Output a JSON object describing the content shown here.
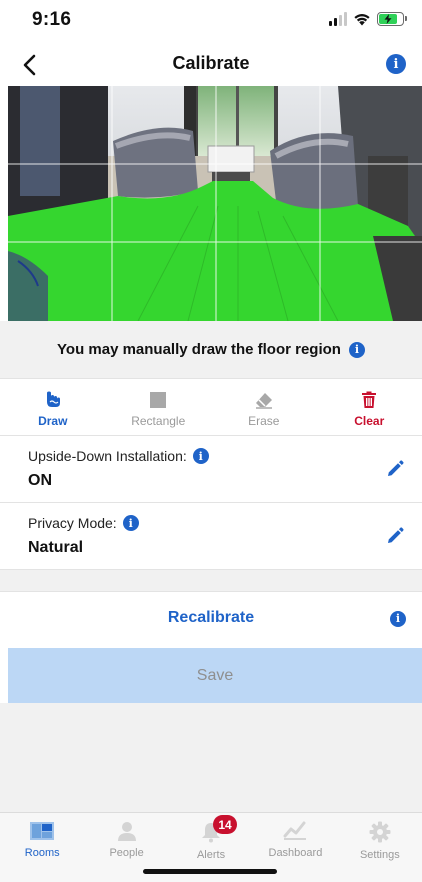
{
  "status_bar": {
    "time": "9:16"
  },
  "nav": {
    "title": "Calibrate"
  },
  "instruction": {
    "text": "You may manually draw the floor region"
  },
  "tools": [
    {
      "label": "Draw",
      "icon": "hand-draw-icon",
      "state": "active"
    },
    {
      "label": "Rectangle",
      "icon": "square-icon",
      "state": "disabled"
    },
    {
      "label": "Erase",
      "icon": "eraser-icon",
      "state": "disabled"
    },
    {
      "label": "Clear",
      "icon": "trash-icon",
      "state": "danger"
    }
  ],
  "settings": {
    "upside_down": {
      "label": "Upside-Down Installation:",
      "value": "ON"
    },
    "privacy": {
      "label": "Privacy Mode:",
      "value": "Natural"
    }
  },
  "actions": {
    "recalibrate": "Recalibrate",
    "save": "Save"
  },
  "tabs": [
    {
      "label": "Rooms",
      "icon": "rooms-icon",
      "active": true
    },
    {
      "label": "People",
      "icon": "person-icon",
      "active": false
    },
    {
      "label": "Alerts",
      "icon": "bell-icon",
      "active": false,
      "badge": "14"
    },
    {
      "label": "Dashboard",
      "icon": "chart-icon",
      "active": false
    },
    {
      "label": "Settings",
      "icon": "gear-icon",
      "active": false
    }
  ],
  "colors": {
    "accent": "#1f63c8",
    "danger": "#c8102e",
    "floor_overlay": "#35d62f",
    "save_disabled": "#bcd7f5"
  }
}
